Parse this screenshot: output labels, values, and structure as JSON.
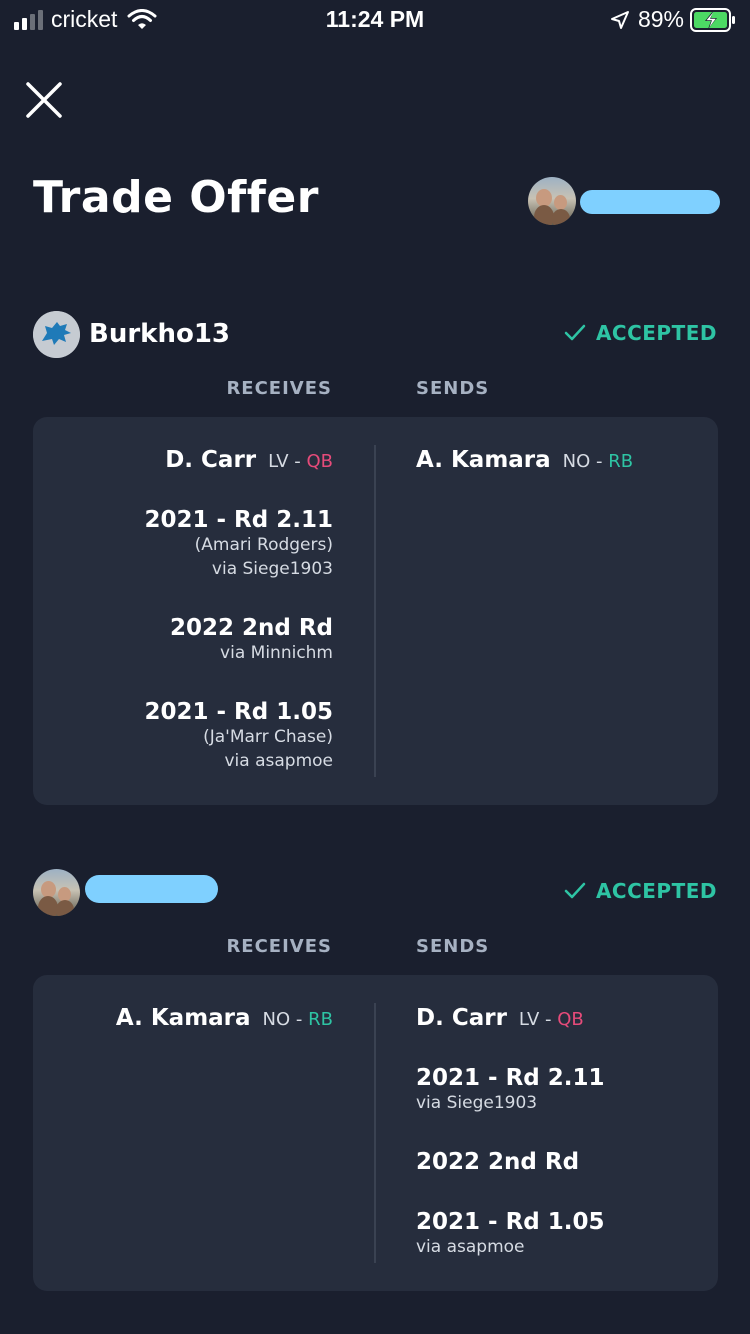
{
  "status_bar": {
    "carrier": "cricket",
    "time": "11:24 PM",
    "battery_pct": "89%"
  },
  "header": {
    "title": "Trade Offer"
  },
  "labels": {
    "accepted": "ACCEPTED",
    "receives": "RECEIVES",
    "sends": "SENDS"
  },
  "parties": [
    {
      "name": "Burkho13",
      "status": "ACCEPTED",
      "receives": [
        {
          "player": "D. Carr",
          "team": "LV",
          "pos": "QB"
        },
        {
          "pick": "2021 - Rd 2.11",
          "sub": [
            "(Amari Rodgers)",
            "via Siege1903"
          ]
        },
        {
          "pick": "2022 2nd Rd",
          "sub": [
            "via Minnichm"
          ]
        },
        {
          "pick": "2021 - Rd 1.05",
          "sub": [
            "(Ja'Marr Chase)",
            "via asapmoe"
          ]
        }
      ],
      "sends": [
        {
          "player": "A. Kamara",
          "team": "NO",
          "pos": "RB"
        }
      ]
    },
    {
      "name": "",
      "status": "ACCEPTED",
      "receives": [
        {
          "player": "A. Kamara",
          "team": "NO",
          "pos": "RB"
        }
      ],
      "sends": [
        {
          "player": "D. Carr",
          "team": "LV",
          "pos": "QB"
        },
        {
          "pick": "2021 - Rd 2.11",
          "sub": [
            "via Siege1903"
          ]
        },
        {
          "pick": "2022 2nd Rd"
        },
        {
          "pick": "2021 - Rd 1.05",
          "sub": [
            "via asapmoe"
          ]
        }
      ]
    }
  ],
  "colors": {
    "background": "#1a1f2e",
    "card": "#262d3d",
    "accepted": "#2ec4a4",
    "qb": "#e64b7a",
    "rb": "#2ec4a4"
  },
  "icons": [
    "close-icon",
    "check-icon",
    "wifi-icon",
    "location-arrow-icon",
    "battery-charging-icon"
  ]
}
